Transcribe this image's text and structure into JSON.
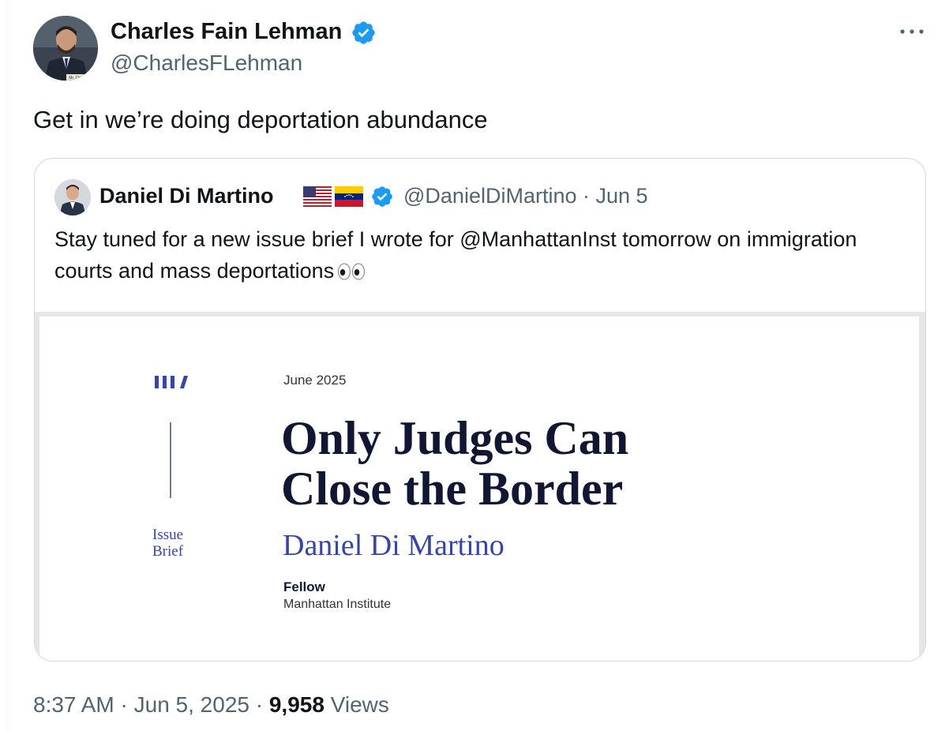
{
  "tweet": {
    "author_name": "Charles Fain Lehman",
    "author_handle": "@CharlesFLehman",
    "text": "Get in we’re doing deportation abundance",
    "time": "8:37 AM",
    "date": "Jun 5, 2025",
    "separator": "·",
    "views_count": "9,958",
    "views_label": "Views",
    "avatar_caption": "Mr. Charles"
  },
  "quote": {
    "author_name": "Daniel Di Martino",
    "author_handle": "@DanielDiMartino",
    "date": "Jun 5",
    "separator": "·",
    "text": "Stay tuned for a new issue brief I wrote for @ManhattanInst tomorrow on immigration courts and mass deportations",
    "emoji_icon": "eyes-icon",
    "flag_icons": [
      "us-flag-icon",
      "venezuela-flag-icon"
    ]
  },
  "media": {
    "date": "June 2025",
    "title_line1": "Only Judges Can",
    "title_line2": "Close the Border",
    "author": "Daniel Di Martino",
    "role": "Fellow",
    "org": "Manhattan Institute",
    "label_line1": "Issue",
    "label_line2": "Brief"
  },
  "colors": {
    "verified": "#1d9bf0",
    "secondary_text": "#536471",
    "border": "#cfd9de",
    "mi_blue": "#3646a1",
    "mi_navy": "#111733"
  }
}
